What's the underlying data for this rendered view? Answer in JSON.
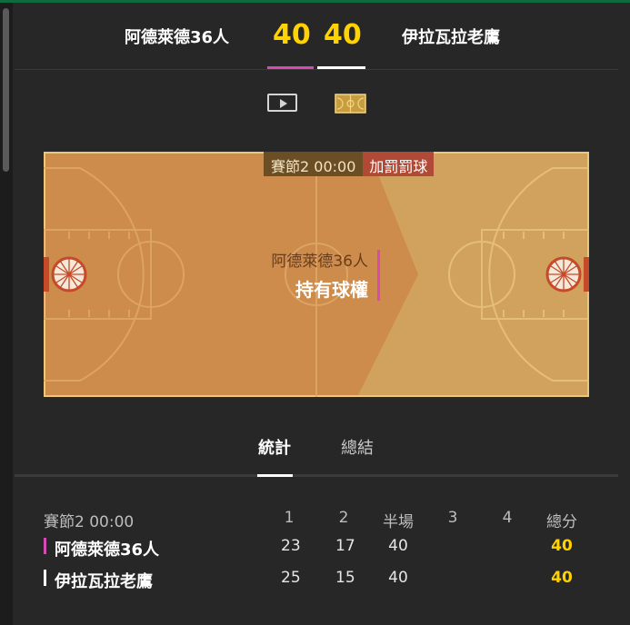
{
  "colors": {
    "background": "#272727",
    "accent_score": "#ffd200",
    "home_color": "#d64bb4",
    "away_color": "#ffffff",
    "court_home_side": "#cd8b4c",
    "court_away_side": "#d1a25e"
  },
  "header": {
    "home_team": "阿德萊德36人",
    "away_team": "伊拉瓦拉老鷹",
    "home_score": "40",
    "away_score": "40"
  },
  "view_icons": [
    {
      "name": "video-icon",
      "active": false
    },
    {
      "name": "court-icon",
      "active": true
    }
  ],
  "court": {
    "quarter_time": "賽節2  00:00",
    "event": "加罰罰球",
    "possession_team": "阿德萊德36人",
    "possession_label": "持有球權"
  },
  "tabs": [
    {
      "label": "統計",
      "active": true
    },
    {
      "label": "總結",
      "active": false
    }
  ],
  "table": {
    "period_label": "賽節2  00:00",
    "headers": [
      "1",
      "2",
      "半場",
      "3",
      "4",
      "總分"
    ],
    "rows": [
      {
        "team": "阿德萊德36人",
        "q1": "23",
        "q2": "17",
        "half": "40",
        "q3": "",
        "q4": "",
        "total": "40"
      },
      {
        "team": "伊拉瓦拉老鷹",
        "q1": "25",
        "q2": "15",
        "half": "40",
        "q3": "",
        "q4": "",
        "total": "40"
      }
    ]
  }
}
